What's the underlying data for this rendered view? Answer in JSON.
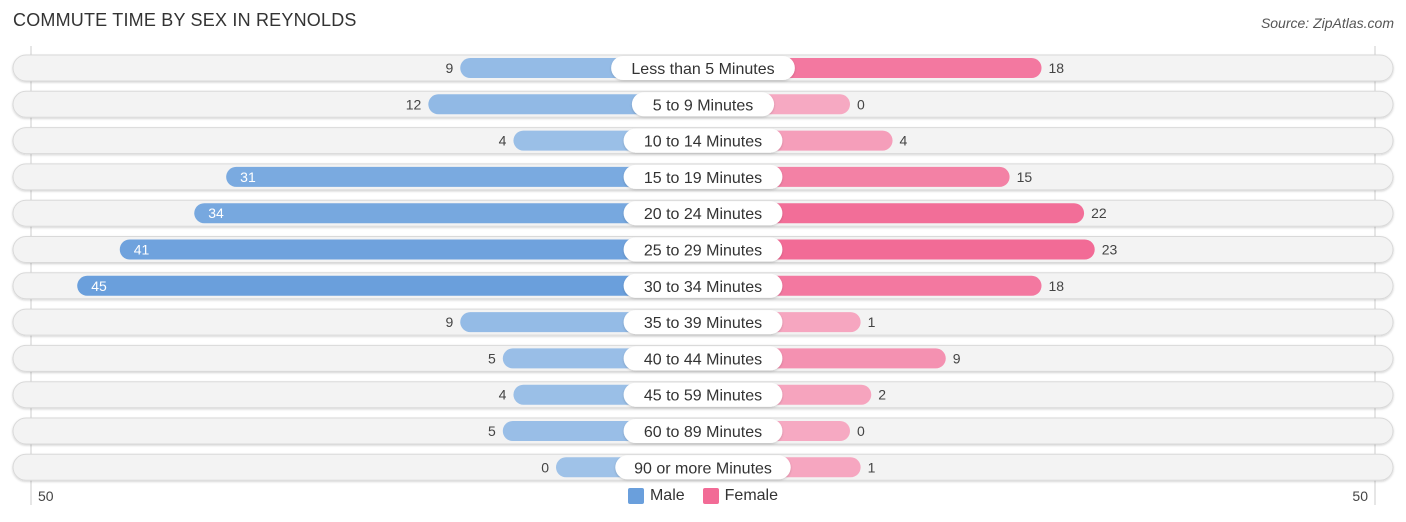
{
  "header": {
    "title": "COMMUTE TIME BY SEX IN REYNOLDS",
    "source": "Source: ZipAtlas.com"
  },
  "axis": {
    "left_label": "50",
    "right_label": "50"
  },
  "legend": {
    "items": [
      {
        "label": "Male",
        "color": "#6a9fdc"
      },
      {
        "label": "Female",
        "color": "#f26b96"
      }
    ]
  },
  "colors": {
    "male_strong": "#6a9fdc",
    "male_light": "#9fc2e8",
    "female_strong": "#f26b96",
    "female_light": "#f6a9c2",
    "row_bg": "#f3f3f3",
    "row_border": "#d9d9d9"
  },
  "chart_data": {
    "type": "bar",
    "orientation": "horizontal-diverging",
    "title": "COMMUTE TIME BY SEX IN REYNOLDS",
    "xlabel": "",
    "ylabel": "",
    "xlim": [
      -50,
      50
    ],
    "legend_position": "bottom-center",
    "categories": [
      "Less than 5 Minutes",
      "5 to 9 Minutes",
      "10 to 14 Minutes",
      "15 to 19 Minutes",
      "20 to 24 Minutes",
      "25 to 29 Minutes",
      "30 to 34 Minutes",
      "35 to 39 Minutes",
      "40 to 44 Minutes",
      "45 to 59 Minutes",
      "60 to 89 Minutes",
      "90 or more Minutes"
    ],
    "series": [
      {
        "name": "Male",
        "values": [
          9,
          12,
          4,
          31,
          34,
          41,
          45,
          9,
          5,
          4,
          5,
          0
        ]
      },
      {
        "name": "Female",
        "values": [
          18,
          0,
          4,
          15,
          22,
          23,
          18,
          1,
          9,
          2,
          0,
          1
        ]
      }
    ]
  }
}
